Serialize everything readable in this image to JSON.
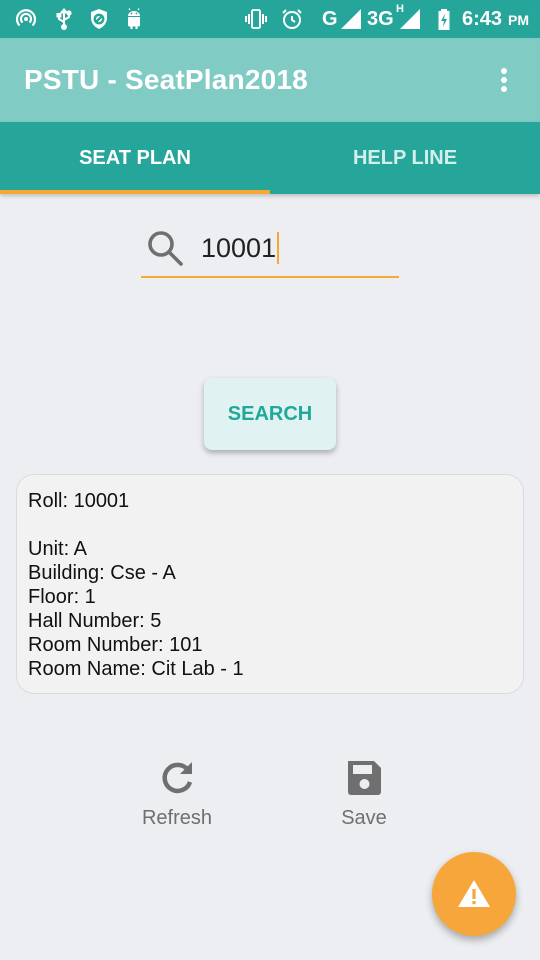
{
  "status_bar": {
    "network_type": "G",
    "network_type_2": "3G",
    "network_superscript": "H",
    "time": "6:43",
    "time_suffix": "PM",
    "icons": [
      "hotspot-icon",
      "usb-icon",
      "blocked-icon",
      "android-icon",
      "vibrate-icon",
      "alarm-icon",
      "signal-icon",
      "signal-3g-icon",
      "battery-charging-icon"
    ]
  },
  "app_bar": {
    "title": "PSTU - SeatPlan2018"
  },
  "tabs": [
    {
      "label": "SEAT PLAN",
      "selected": true
    },
    {
      "label": "HELP LINE",
      "selected": false
    }
  ],
  "search": {
    "value": "10001",
    "button_label": "SEARCH"
  },
  "result": {
    "roll": "Roll: 10001",
    "unit": "Unit: A",
    "building": "Building: Cse - A",
    "floor": "Floor: 1",
    "hall_number": "Hall Number: 5",
    "room_number": "Room Number: 101",
    "room_name": "Room Name: Cit Lab - 1"
  },
  "actions": {
    "refresh_label": "Refresh",
    "save_label": "Save"
  },
  "fab": {
    "icon": "warning-icon"
  },
  "colors": {
    "primary": "#26a69a",
    "app_bar": "#80cbc4",
    "accent": "#f7a831",
    "background": "#eceef1"
  }
}
